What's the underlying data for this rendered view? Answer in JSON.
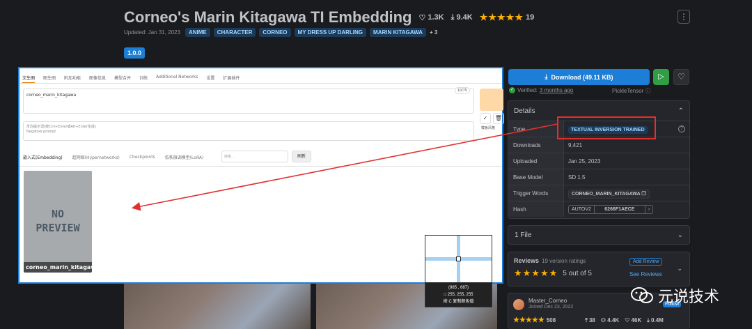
{
  "header": {
    "title": "Corneo's Marin Kitagawa TI Embedding",
    "likes": "1.3K",
    "downloads": "9.4K",
    "rating_count": "19",
    "menu_icon": "more-vertical-icon",
    "updated": "Updated: Jan 31, 2023",
    "tags": [
      "ANIME",
      "CHARACTER",
      "CORNEO",
      "MY DRESS UP DARLING",
      "MARIN KITAGAWA"
    ],
    "more_tags": "+ 3",
    "version": "1.0.0"
  },
  "webui": {
    "tabs": [
      "文生图",
      "图生图",
      "附加功能",
      "图像信息",
      "模型合并",
      "训练",
      "Additional Networks",
      "设置",
      "扩展插件"
    ],
    "prompt": "corneo_marin_kitagawa",
    "token_counter": "10/75",
    "negative_placeholder": "反向提示词(按Ctrl+Enter或Alt+Enter生成)",
    "negative_label": "Negative prompt",
    "style_label": "模板风格",
    "sub_tabs": [
      "嵌入式(Embedding)",
      "超网络(Hypernetworks)",
      "Checkpoints",
      "低秩微调模型(LoRA)"
    ],
    "search_placeholder": "搜索...",
    "refresh": "刷新",
    "card_preview": "NO\nPREVIEW",
    "card_name": "corneo_marin_kitagawa",
    "check_icon": "✓",
    "trash_icon": "🗑"
  },
  "picker": {
    "coords": "(985 , 687)",
    "rgb": "255, 255, 255",
    "hint": "按 C 复制颜色值"
  },
  "sidebar": {
    "download_label": "Download (49.11 KB)",
    "verified_text": "Verified:",
    "verified_time": "3 months ago",
    "pickle": "PickleTensor",
    "details_title": "Details",
    "rows": {
      "type_k": "Type",
      "type_v": "TEXTUAL INVERSION TRAINED",
      "downloads_k": "Downloads",
      "downloads_v": "9,421",
      "uploaded_k": "Uploaded",
      "uploaded_v": "Jan 25, 2023",
      "base_k": "Base Model",
      "base_v": "SD 1.5",
      "trigger_k": "Trigger Words",
      "trigger_v": "CORNEO_MARIN_KITAGAWA",
      "hash_k": "Hash",
      "hash_algo": "AUTOV2",
      "hash_v": "6266F1AECE"
    },
    "files": "1 File",
    "reviews": {
      "title": "Reviews",
      "count": "19 version ratings",
      "score": "5 out of 5",
      "add": "Add Review",
      "see": "See Reviews"
    },
    "creator": {
      "name": "Master_Corneo",
      "joined": "Joined Dec 23, 2022",
      "follow": "Follow",
      "rating_count": "508",
      "uploads": "38",
      "followers": "4.4K",
      "likes": "46K",
      "downloads": "0.4M"
    }
  },
  "watermark": "元说技术"
}
